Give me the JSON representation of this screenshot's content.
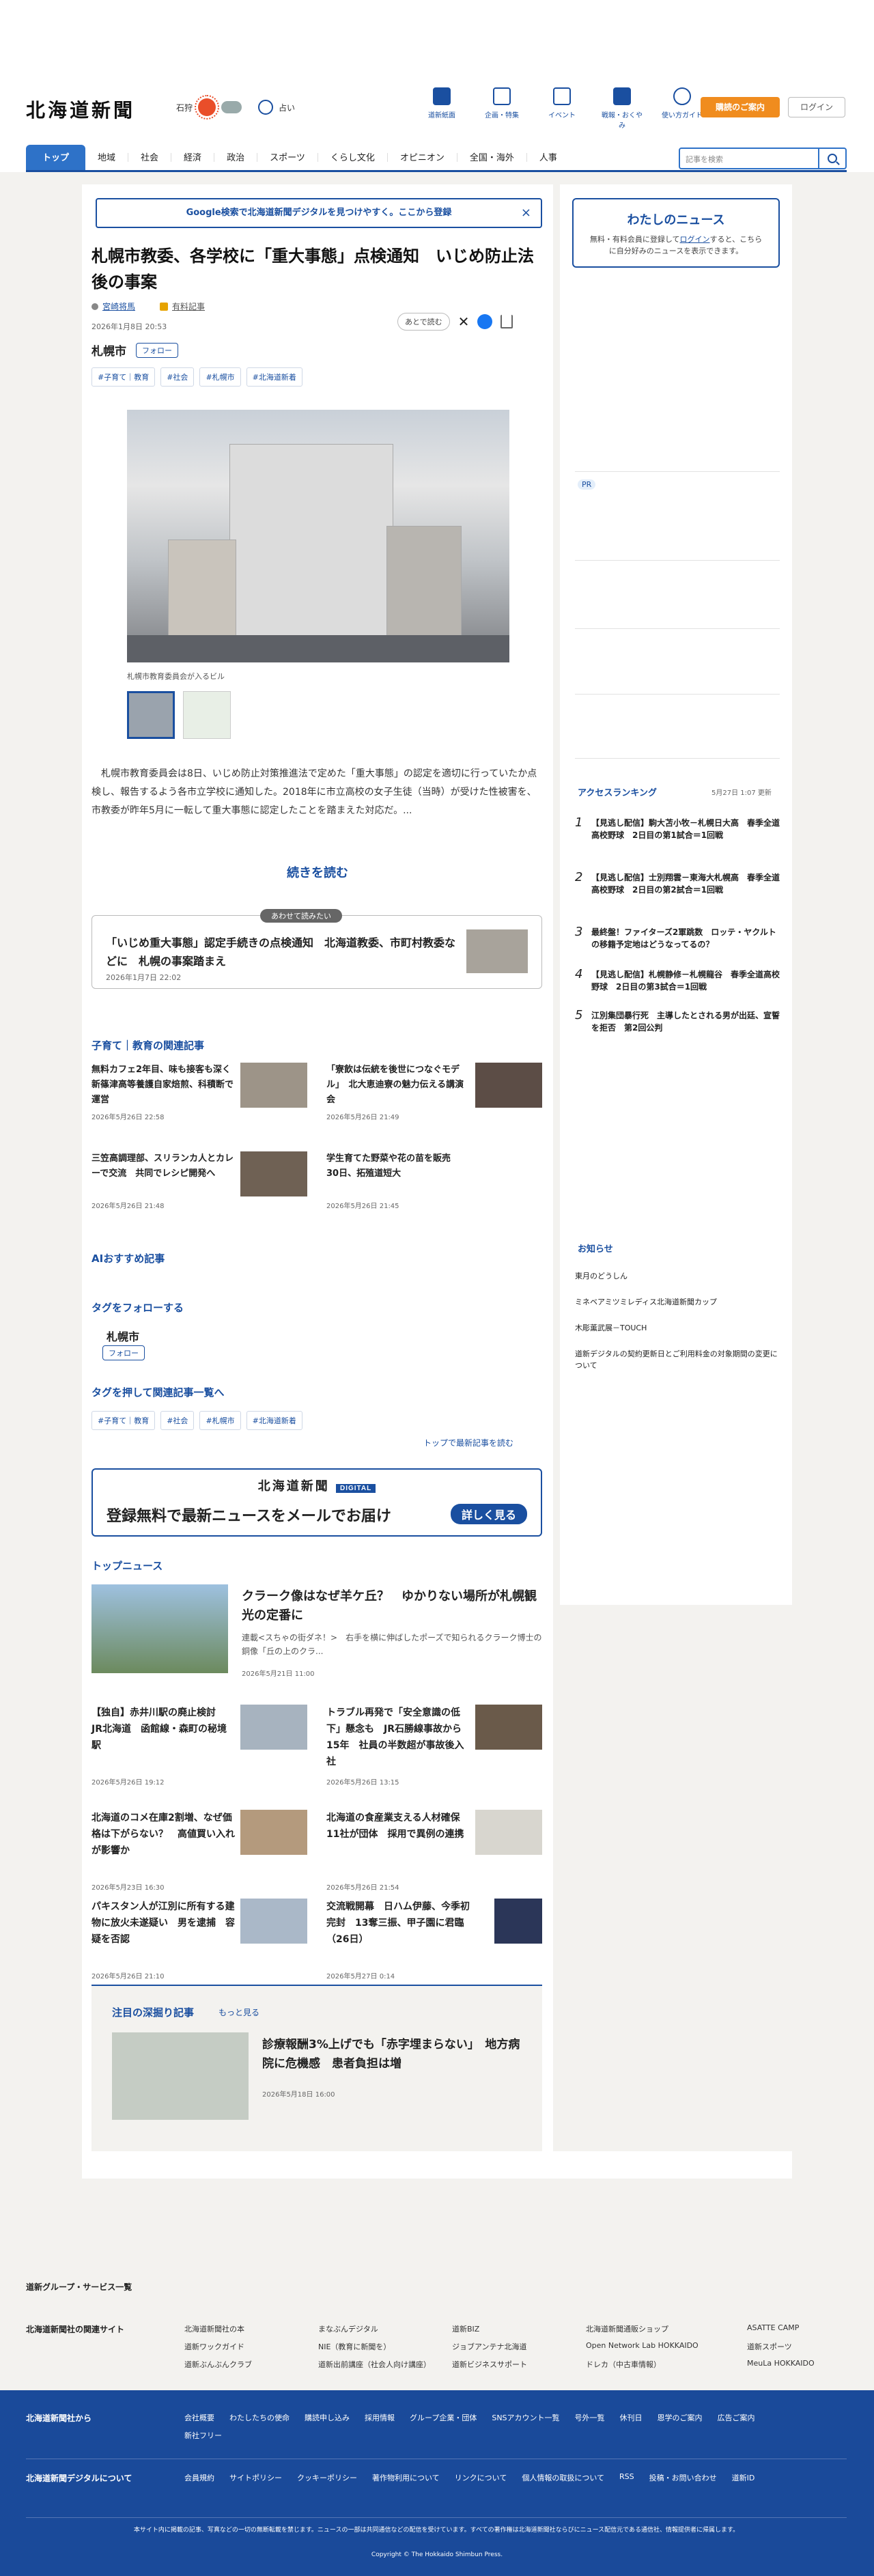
{
  "header": {
    "logo": "北海道新聞",
    "weather_city": "石狩",
    "weather_note": "占い",
    "icons": [
      {
        "label": "道新紙面",
        "icon": "paper-icon"
      },
      {
        "label": "企画・特集",
        "icon": "flag-icon"
      },
      {
        "label": "イベント",
        "icon": "calendar-icon"
      },
      {
        "label": "戦報・おくやみ",
        "icon": "book-icon"
      },
      {
        "label": "使い方ガイド",
        "icon": "help-icon"
      }
    ],
    "subscribe": "購読のご案内",
    "login": "ログイン"
  },
  "nav": {
    "items": [
      "トップ",
      "地域",
      "社会",
      "経済",
      "政治",
      "スポーツ",
      "くらし文化",
      "オピニオン",
      "全国・海外",
      "人事"
    ],
    "search_placeholder": "記事を検索"
  },
  "banner": {
    "text": "Google検索で北海道新聞デジタルを見つけやすく。ここから登録",
    "close": "×"
  },
  "article": {
    "title": "札幌市教委、各学校に「重大事態」点検通知　いじめ防止法後の事案",
    "author": "宮崎将馬",
    "badge": "有料記事",
    "date": "2026年1月8日 20:53",
    "later": "あとで読む",
    "location": "札幌市",
    "follow": "フォロー",
    "tags": [
      "#子育て｜教育",
      "#社会",
      "#札幌市",
      "#北海道新着"
    ],
    "caption": "札幌市教育委員会が入るビル",
    "body": "　札幌市教育委員会は8日、いじめ防止対策推進法で定めた「重大事態」の認定を適切に行っていたか点検し、報告するよう各市立学校に通知した。2018年に市立高校の女子生徒（当時）が受けた性被害を、市教委が昨年5月に一転して重大事態に認定したことを踏まえた対応だ。...",
    "readmore": "続きを読む"
  },
  "together": {
    "label": "あわせて読みたい",
    "title": "「いじめ重大事態」認定手続きの点検通知　北海道教委、市町村教委などに　札幌の事案踏まえ",
    "date": "2026年1月7日 22:02"
  },
  "related": {
    "heading": "子育て｜教育の関連記事",
    "items": [
      {
        "title": "無料カフェ2年目、味も接客も深く　新篠津高等養護自家焙煎、科積断で運営",
        "date": "2026年5月26日 22:58"
      },
      {
        "title": "「寮飲は伝統を後世につなぐモデル」　北大恵迪寮の魅力伝える講演会",
        "date": "2026年5月26日 21:49"
      },
      {
        "title": "三笠高調理部、スリランカ人とカレーで交流　共同でレシピ開発へ",
        "date": "2026年5月26日 21:48"
      },
      {
        "title": "学生育てた野菜や花の苗を販売　30日、拓殖道短大",
        "date": "2026年5月26日 21:45"
      }
    ]
  },
  "ai_heading": "AIおすすめ記事",
  "follow_tags": {
    "heading": "タグをフォローする",
    "name": "札幌市",
    "btn": "フォロー",
    "push_heading": "タグを押して関連記事一覧へ",
    "to_latest": "トップで最新記事を読む"
  },
  "mail": {
    "logo": "北海道新聞",
    "digital": "DIGITAL",
    "big": "登録無料で最新ニュースをメールでお届け",
    "btn": "詳しく見る"
  },
  "top_news": {
    "heading": "トップニュース",
    "lead": {
      "title": "クラーク像はなぜ羊ケ丘？　ゆかりない場所が札幌観光の定番に",
      "desc": "連載<スちゃの街ダネ！>　右手を横に伸ばしたポーズで知られるクラーク博士の銅像「丘の上のクラ...",
      "date": "2026年5月21日 11:00"
    },
    "items": [
      {
        "title": "【独自】赤井川駅の廃止検討　JR北海道　函館線・森町の秘境駅",
        "date": "2026年5月26日 19:12"
      },
      {
        "title": "トラブル再発で「安全意識の低下」懸念も　JR石勝線事故から15年　社員の半数超が事故後入社",
        "date": "2026年5月26日 13:15"
      },
      {
        "title": "北海道のコメ在庫2割増、なぜ価格は下がらない？　高値買い入れが影響か",
        "date": "2026年5月23日 16:30"
      },
      {
        "title": "北海道の食産業支える人材確保　11社が団体　採用で異例の連携",
        "date": "2026年5月26日 21:54"
      },
      {
        "title": "パキスタン人が江別に所有する建物に放火未遂疑い　男を逮捕　容疑を否認",
        "date": "2026年5月26日 21:10"
      },
      {
        "title": "交流戦開幕　日ハム伊藤、今季初完封　13奪三振、甲子園に君臨（26日）",
        "date": "2026年5月27日 0:14"
      }
    ]
  },
  "deep": {
    "heading": "注目の深掘り記事",
    "more": "もっと見る",
    "title": "診療報酬3%上げでも「赤字埋まらない」　地方病院に危機感　患者負担は増",
    "date": "2026年5月18日 16:00"
  },
  "side": {
    "mynews_title": "わたしのニュース",
    "mynews_text": "無料・有料会員に登録して",
    "mynews_login": "ログイン",
    "mynews_text2": "すると、こちらに自分好みのニュースを表示できます。",
    "pr": "PR",
    "ranking_heading": "アクセスランキング",
    "ranking_updated": "5月27日 1:07 更新",
    "ranking": [
      {
        "n": "1",
        "t": "【見逃し配信】駒大苫小牧－札幌日大高　春季全道高校野球　2日目の第1試合＝1回戦"
      },
      {
        "n": "2",
        "t": "【見逃し配信】士別翔雲－東海大札幌高　春季全道高校野球　2日目の第2試合＝1回戦"
      },
      {
        "n": "3",
        "t": "最終盤！ファイターズ2軍跳数　ロッテ・ヤクルトの移籍予定地はどうなってるの？"
      },
      {
        "n": "4",
        "t": "【見逃し配信】札幌静修－札幌龍谷　春季全道高校野球　2日目の第3試合＝1回戦"
      },
      {
        "n": "5",
        "t": "江別集団暴行死　主導したとされる男が出廷、宣誓を拒否　第2回公判"
      }
    ],
    "info_heading": "お知らせ",
    "info": [
      "東月のどうしん",
      "ミネベアミツミレディス北海道新聞カップ",
      "木彫薫武展－TOUCH",
      "道新デジタルの契約更新日とご利用料金の対象期間の変更について"
    ]
  },
  "footer": {
    "group": "道新グループ・サービス一覧",
    "sites_label": "北海道新聞社の関連サイト",
    "sites": [
      "北海道新聞社の本",
      "まなぶんデジタル",
      "道新BIZ",
      "北海道新聞通販ショップ",
      "ASATTE CAMP",
      "道新ワックガイド",
      "NIE（教育に新聞を）",
      "ジョブアンテナ北海道",
      "Open Network Lab HOKKAIDO",
      "道新スポーツ",
      "道新ぶんぶんクラブ",
      "道新出前講座（社会人向け講座）",
      "道新ビジネスサポート",
      "ドレカ（中古車情報）",
      "MeuLa HOKKAIDO"
    ],
    "from_label": "北海道新聞社から",
    "from": [
      "会社概要",
      "わたしたちの使命",
      "購読申し込み",
      "採用情報",
      "グループ企業・団体",
      "SNSアカウント一覧",
      "号外一覧",
      "休刊日",
      "恩学のご案内",
      "広告ご案内",
      "新社フリー"
    ],
    "about_label": "北海道新聞デジタルについて",
    "about": [
      "会員規約",
      "サイトポリシー",
      "クッキーポリシー",
      "著作物利用について",
      "リンクについて",
      "個人情報の取扱について",
      "RSS",
      "投稿・お問い合わせ",
      "道新ID"
    ],
    "notice": "本サイト内に掲載の記事、写真などの一切の無断転載を禁じます。ニュースの一部は共同通信などの配信を受けています。すべての著作権は北海道新聞社ならびにニュース配信元である通信社、情報提供者に帰属します。",
    "copyright": "Copyright © The Hokkaido Shimbun Press."
  }
}
